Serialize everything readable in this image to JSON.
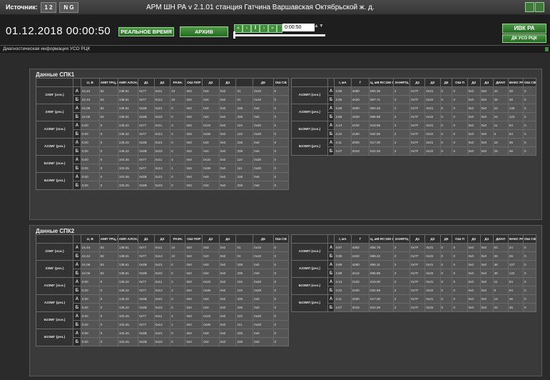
{
  "header": {
    "source_label": "Источник:",
    "src_btn_1": "1 2",
    "src_btn_2": "N G",
    "title": "АРМ ШН РА v 2.1.01  станция  Гатчина Варшавская  Октябрьской  ж. д."
  },
  "toolbar": {
    "datetime": "01.12.2018 00:00:50",
    "realtime_label": "РЕАЛЬНОЕ ВРЕМЯ",
    "archive_label": "АРХИВ",
    "time_value": "0:00:50",
    "ivk_label": "ИВК РА",
    "dk_label": "ДК УСО РЦК"
  },
  "status": {
    "diag_label": "Диагностическая информация УСО РЦК"
  },
  "colors": {
    "accent_green": "#3e8b3a",
    "panel": "#3a3a3a",
    "background": "#2b2b2b"
  },
  "spk1": {
    "title": "Данные СПК1",
    "left_headers": [
      "",
      "",
      "U, В",
      "АМП ТРЦ, В",
      "АМП АЛСН, В",
      "Д1",
      "Д3",
      "РАЗН.",
      "ОШ ПОР",
      "Д2",
      "Д4",
      "",
      "Д5",
      "ОШ СВ"
    ],
    "left_groups": [
      {
        "name": "23МГ (осн.)",
        "rows": [
          {
            "ab": "А",
            "cells": [
              "24.44",
              "62",
              "138.61",
              "0x77",
              "0x11",
              "10",
              "0x0",
              "0x0",
              "0x0",
              "01",
              "0x10",
              "0"
            ]
          },
          {
            "ab": "Б",
            "cells": [
              "24.44",
              "62",
              "138.61",
              "0x77",
              "0x12",
              "10",
              "0x0",
              "0x0",
              "0x0",
              "01",
              "0x10",
              "0"
            ]
          }
        ]
      },
      {
        "name": "23МГ (рез.)",
        "rows": [
          {
            "ab": "А",
            "cells": [
              "24.06",
              "62",
              "138.61",
              "0x3B",
              "0x21",
              "0",
              "0x0",
              "0x0",
              "0x0",
              "235",
              "0x0",
              "0"
            ]
          },
          {
            "ab": "Б",
            "cells": [
              "24.06",
              "62",
              "138.61",
              "0x3B",
              "0x22",
              "0",
              "0x0",
              "0x0",
              "0x0",
              "235",
              "0x0",
              "0"
            ]
          }
        ]
      },
      {
        "name": "А23МГ (осн.)",
        "rows": [
          {
            "ab": "А",
            "cells": [
              "0.00",
              "0",
              "128.22",
              "0x77",
              "0x11",
              "3",
              "0x0",
              "0x10",
              "0x0",
              "119",
              "0x20",
              "0"
            ]
          },
          {
            "ab": "Б",
            "cells": [
              "0.00",
              "0",
              "128.22",
              "0x77",
              "0x12",
              "3",
              "0x0",
              "0x36",
              "0x0",
              "119",
              "0x20",
              "0"
            ]
          }
        ]
      },
      {
        "name": "А23МГ (рез.)",
        "rows": [
          {
            "ab": "А",
            "cells": [
              "0.00",
              "0",
              "128.22",
              "0x3B",
              "0x21",
              "0",
              "0x0",
              "0x0",
              "0x0",
              "235",
              "0x0",
              "0"
            ]
          },
          {
            "ab": "Б",
            "cells": [
              "0.00",
              "0",
              "128.22",
              "0x3B",
              "0x22",
              "0",
              "0x0",
              "0x0",
              "0x0",
              "235",
              "0x0",
              "0"
            ]
          }
        ]
      },
      {
        "name": "Б23МГ (осн.)",
        "rows": [
          {
            "ab": "А",
            "cells": [
              "0.00",
              "0",
              "103.25",
              "0x77",
              "0x11",
              "4",
              "0x0",
              "0x10",
              "0x0",
              "110",
              "0x20",
              "0"
            ]
          },
          {
            "ab": "Б",
            "cells": [
              "0.00",
              "0",
              "103.25",
              "0x77",
              "0x12",
              "1",
              "0x0",
              "0x36",
              "0x0",
              "111",
              "0x20",
              "0"
            ]
          }
        ]
      },
      {
        "name": "Б23МГ (рез.)",
        "rows": [
          {
            "ab": "А",
            "cells": [
              "0.00",
              "0",
              "103.25",
              "0x3B",
              "0x21",
              "0",
              "0x0",
              "0x0",
              "0x0",
              "235",
              "0x0",
              "0"
            ]
          },
          {
            "ab": "Б",
            "cells": [
              "0.00",
              "0",
              "103.25",
              "0x3B",
              "0x22",
              "0",
              "0x0",
              "0x0",
              "0x0",
              "235",
              "0x0",
              "0"
            ]
          }
        ]
      }
    ],
    "right_headers": [
      "",
      "",
      "I, мА",
      "f",
      "Ц, мВ Rt=150 Ом",
      "ЗАНЯТЦ",
      "Д1",
      "Д3",
      "Д5",
      "ОШ П",
      "Д2",
      "Д4",
      "ДИАП",
      "МАКС РАЗН",
      "ОШ СВ"
    ],
    "right_groups": [
      {
        "name": "А23МП (осн.)",
        "rows": [
          {
            "ab": "А",
            "cells": [
              "3.96",
              "4280",
              "894.36",
              "2",
              "0x7F",
              "0x21",
              "0",
              "0",
              "0x0",
              "0x0",
              "43",
              "38",
              "0"
            ]
          },
          {
            "ab": "Б",
            "cells": [
              "3.95",
              "4420",
              "897.71",
              "2",
              "0x7F",
              "0x22",
              "0",
              "0",
              "0x0",
              "0x0",
              "28",
              "38",
              "0"
            ]
          }
        ]
      },
      {
        "name": "А23МП (рез.)",
        "rows": [
          {
            "ab": "А",
            "cells": [
              "3.89",
              "4280",
              "883.26",
              "2",
              "0x7F",
              "0x21",
              "0",
              "0",
              "0x0",
              "0x0",
              "22",
              "126",
              "0"
            ]
          },
          {
            "ab": "Б",
            "cells": [
              "3.88",
              "4400",
              "896.89",
              "2",
              "0x7F",
              "0x22",
              "0",
              "0",
              "0x0",
              "0x0",
              "24",
              "123",
              "0"
            ]
          }
        ]
      },
      {
        "name": "Б23МП (осн.)",
        "rows": [
          {
            "ab": "А",
            "cells": [
              "4.13",
              "2102",
              "618.66",
              "2",
              "0x7F",
              "0x21",
              "0",
              "0",
              "0x0",
              "0x0",
              "11",
              "84",
              "0"
            ]
          },
          {
            "ab": "Б",
            "cells": [
              "4.22",
              "2190",
              "632.50",
              "2",
              "0x7F",
              "0x22",
              "0",
              "0",
              "0x0",
              "0x0",
              "6",
              "84",
              "0"
            ]
          }
        ]
      },
      {
        "name": "Б23МП (рез.)",
        "rows": [
          {
            "ab": "А",
            "cells": [
              "4.11",
              "2000",
              "617.00",
              "2",
              "0x7F",
              "0x21",
              "0",
              "0",
              "0x0",
              "0x0",
              "18",
              "46",
              "0"
            ]
          },
          {
            "ab": "Б",
            "cells": [
              "4.07",
              "2043",
              "610.26",
              "2",
              "0x7F",
              "0x22",
              "0",
              "0",
              "0x0",
              "0x0",
              "25",
              "46",
              "0"
            ]
          }
        ]
      }
    ]
  },
  "spk2": {
    "title": "Данные СПК2",
    "left_headers": [
      "",
      "",
      "U, В",
      "АМП ТРЦ, В",
      "АМП АЛСН, В",
      "Д1",
      "Д3",
      "РАЗН.",
      "ОШ ПОР",
      "Д2",
      "Д4",
      "",
      "Д5",
      "ОШ СВ"
    ],
    "left_groups": [
      {
        "name": "23МГ (осн.)",
        "rows": [
          {
            "ab": "А",
            "cells": [
              "24.44",
              "62",
              "138.61",
              "0x77",
              "0x11",
              "10",
              "0x0",
              "0x0",
              "0x0",
              "01",
              "0x10",
              "0"
            ]
          },
          {
            "ab": "Б",
            "cells": [
              "24.44",
              "62",
              "138.61",
              "0x77",
              "0x12",
              "10",
              "0x0",
              "0x0",
              "0x0",
              "01",
              "0x10",
              "0"
            ]
          }
        ]
      },
      {
        "name": "23МГ (рез.)",
        "rows": [
          {
            "ab": "А",
            "cells": [
              "24.06",
              "62",
              "138.61",
              "0x3B",
              "0x21",
              "0",
              "0x0",
              "0x0",
              "0x0",
              "235",
              "0x0",
              "0"
            ]
          },
          {
            "ab": "Б",
            "cells": [
              "24.06",
              "62",
              "138.61",
              "0x3B",
              "0x22",
              "0",
              "0x0",
              "0x0",
              "0x0",
              "235",
              "0x0",
              "0"
            ]
          }
        ]
      },
      {
        "name": "А23МГ (осн.)",
        "rows": [
          {
            "ab": "А",
            "cells": [
              "0.00",
              "0",
              "128.22",
              "0x77",
              "0x11",
              "2",
              "0x0",
              "0x10",
              "0x0",
              "119",
              "0x20",
              "0"
            ]
          },
          {
            "ab": "Б",
            "cells": [
              "0.00",
              "0",
              "128.22",
              "0x77",
              "0x12",
              "2",
              "0x0",
              "0x36",
              "0x0",
              "119",
              "0x20",
              "0"
            ]
          }
        ]
      },
      {
        "name": "А23МГ (рез.)",
        "rows": [
          {
            "ab": "А",
            "cells": [
              "0.00",
              "0",
              "128.22",
              "0x3B",
              "0x21",
              "0",
              "0x0",
              "0x0",
              "0x0",
              "235",
              "0x0",
              "0"
            ]
          },
          {
            "ab": "Б",
            "cells": [
              "0.00",
              "0",
              "128.22",
              "0x3B",
              "0x22",
              "0",
              "0x0",
              "0x0",
              "0x0",
              "235",
              "0x0",
              "0"
            ]
          }
        ]
      },
      {
        "name": "Б23МГ (осн.)",
        "rows": [
          {
            "ab": "А",
            "cells": [
              "0.00",
              "0",
              "103.25",
              "0x77",
              "0x11",
              "4",
              "0x0",
              "0x10",
              "0x0",
              "110",
              "0x20",
              "0"
            ]
          },
          {
            "ab": "Б",
            "cells": [
              "0.00",
              "0",
              "103.25",
              "0x77",
              "0x12",
              "1",
              "0x0",
              "0x36",
              "0x0",
              "111",
              "0x20",
              "0"
            ]
          }
        ]
      },
      {
        "name": "Б23МГ (рез.)",
        "rows": [
          {
            "ab": "А",
            "cells": [
              "0.00",
              "0",
              "103.25",
              "0x3B",
              "0x21",
              "0",
              "0x0",
              "0x0",
              "0x0",
              "235",
              "0x0",
              "0"
            ]
          },
          {
            "ab": "Б",
            "cells": [
              "0.00",
              "0",
              "103.25",
              "0x3B",
              "0x22",
              "0",
              "0x0",
              "0x0",
              "0x0",
              "235",
              "0x0",
              "0"
            ]
          }
        ]
      }
    ],
    "right_headers": [
      "",
      "",
      "I, мА",
      "f",
      "Ц, мВ Rt=150 Ом",
      "ЗАНЯТЦ",
      "Д1",
      "Д3",
      "Д5",
      "ОШ П",
      "Д2",
      "Д4",
      "ДИАП",
      "МАКС РАЗН",
      "ОШ СВ"
    ],
    "right_groups": [
      {
        "name": "А23МП (осн.)",
        "rows": [
          {
            "ab": "А",
            "cells": [
              "3.97",
              "4282",
              "894.79",
              "2",
              "0x7F",
              "0x21",
              "0",
              "0",
              "0x0",
              "0x0",
              "53",
              "24",
              "0"
            ]
          },
          {
            "ab": "Б",
            "cells": [
              "3.96",
              "4420",
              "898.42",
              "2",
              "0x7F",
              "0x22",
              "0",
              "0",
              "0x0",
              "0x0",
              "55",
              "28",
              "0"
            ]
          }
        ]
      },
      {
        "name": "А23МП (рез.)",
        "rows": [
          {
            "ab": "А",
            "cells": [
              "3.89",
              "4280",
              "884.11",
              "2",
              "0x7F",
              "0x21",
              "0",
              "0",
              "0x0",
              "0x0",
              "46",
              "127",
              "0"
            ]
          },
          {
            "ab": "Б",
            "cells": [
              "3.88",
              "4412",
              "896.89",
              "2",
              "0x7F",
              "0x22",
              "0",
              "0",
              "0x0",
              "0x0",
              "36",
              "122",
              "0"
            ]
          }
        ]
      },
      {
        "name": "Б23МП (осн.)",
        "rows": [
          {
            "ab": "А",
            "cells": [
              "4.13",
              "2102",
              "619.00",
              "2",
              "0x7F",
              "0x21",
              "0",
              "0",
              "0x0",
              "0x0",
              "11",
              "84",
              "0"
            ]
          },
          {
            "ab": "Б",
            "cells": [
              "4.22",
              "2190",
              "632.69",
              "2",
              "0x7F",
              "0x22",
              "0",
              "0",
              "0x0",
              "0x0",
              "6",
              "84",
              "0"
            ]
          }
        ]
      },
      {
        "name": "Б23МП (рез.)",
        "rows": [
          {
            "ab": "А",
            "cells": [
              "4.11",
              "2000",
              "617.00",
              "2",
              "0x7F",
              "0x21",
              "0",
              "0",
              "0x0",
              "0x0",
              "13",
              "46",
              "0"
            ]
          },
          {
            "ab": "Б",
            "cells": [
              "4.07",
              "2043",
              "610.26",
              "2",
              "0x7F",
              "0x22",
              "0",
              "0",
              "0x0",
              "0x0",
              "22",
              "46",
              "0"
            ]
          }
        ]
      }
    ]
  }
}
